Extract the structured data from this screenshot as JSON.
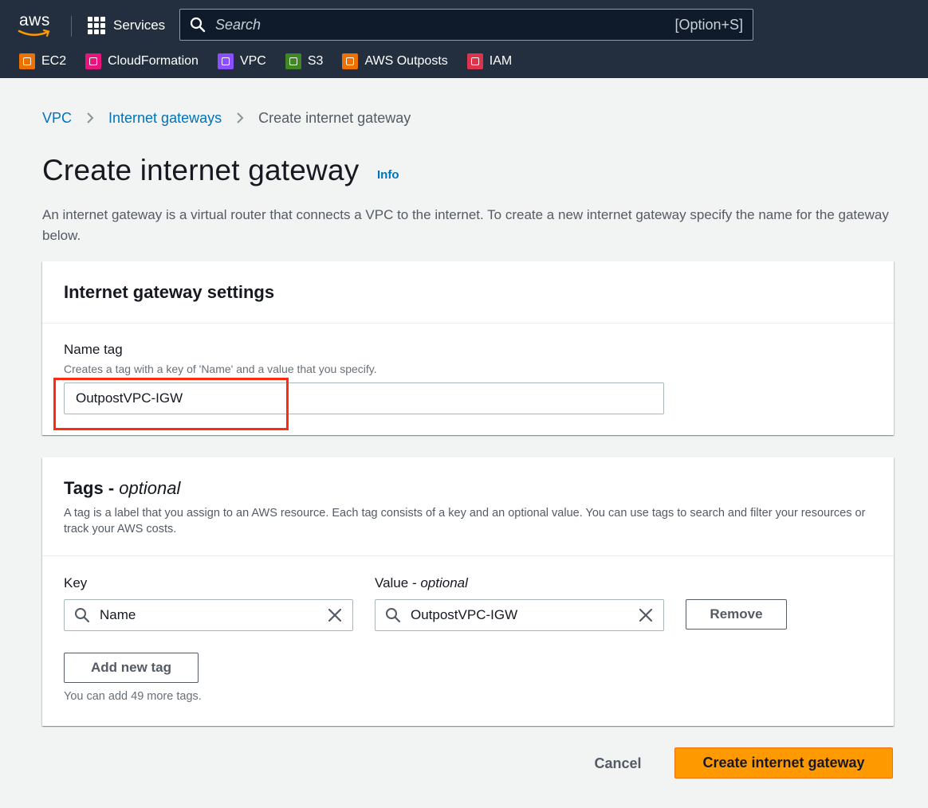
{
  "topnav": {
    "logo_text": "aws",
    "services_label": "Services",
    "search_placeholder": "Search",
    "search_shortcut": "[Option+S]",
    "favorites": [
      {
        "label": "EC2",
        "color": "#ed7100"
      },
      {
        "label": "CloudFormation",
        "color": "#e7157b"
      },
      {
        "label": "VPC",
        "color": "#8c4fff"
      },
      {
        "label": "S3",
        "color": "#3f8624"
      },
      {
        "label": "AWS Outposts",
        "color": "#ed7100"
      },
      {
        "label": "IAM",
        "color": "#dd344c"
      }
    ]
  },
  "breadcrumb": {
    "items": [
      "VPC",
      "Internet gateways"
    ],
    "current": "Create internet gateway"
  },
  "page": {
    "title": "Create internet gateway",
    "info_label": "Info",
    "description": "An internet gateway is a virtual router that connects a VPC to the internet. To create a new internet gateway specify the name for the gateway below."
  },
  "settings": {
    "title": "Internet gateway settings",
    "name_tag_label": "Name tag",
    "name_tag_desc": "Creates a tag with a key of 'Name' and a value that you specify.",
    "name_tag_value": "OutpostVPC-IGW"
  },
  "tags": {
    "title": "Tags - ",
    "title_optional": "optional",
    "description": "A tag is a label that you assign to an AWS resource. Each tag consists of a key and an optional value. You can use tags to search and filter your resources or track your AWS costs.",
    "key_label": "Key",
    "value_label": "Value - ",
    "value_optional": "optional",
    "key_value": "Name",
    "value_value": "OutpostVPC-IGW",
    "remove_label": "Remove",
    "add_label": "Add new tag",
    "hint": "You can add 49 more tags."
  },
  "footer": {
    "cancel_label": "Cancel",
    "create_label": "Create internet gateway"
  },
  "colors": {
    "nav_bg": "#232f3e",
    "link": "#0073bb",
    "primary": "#ff9900",
    "highlight": "#ff2b0e"
  }
}
